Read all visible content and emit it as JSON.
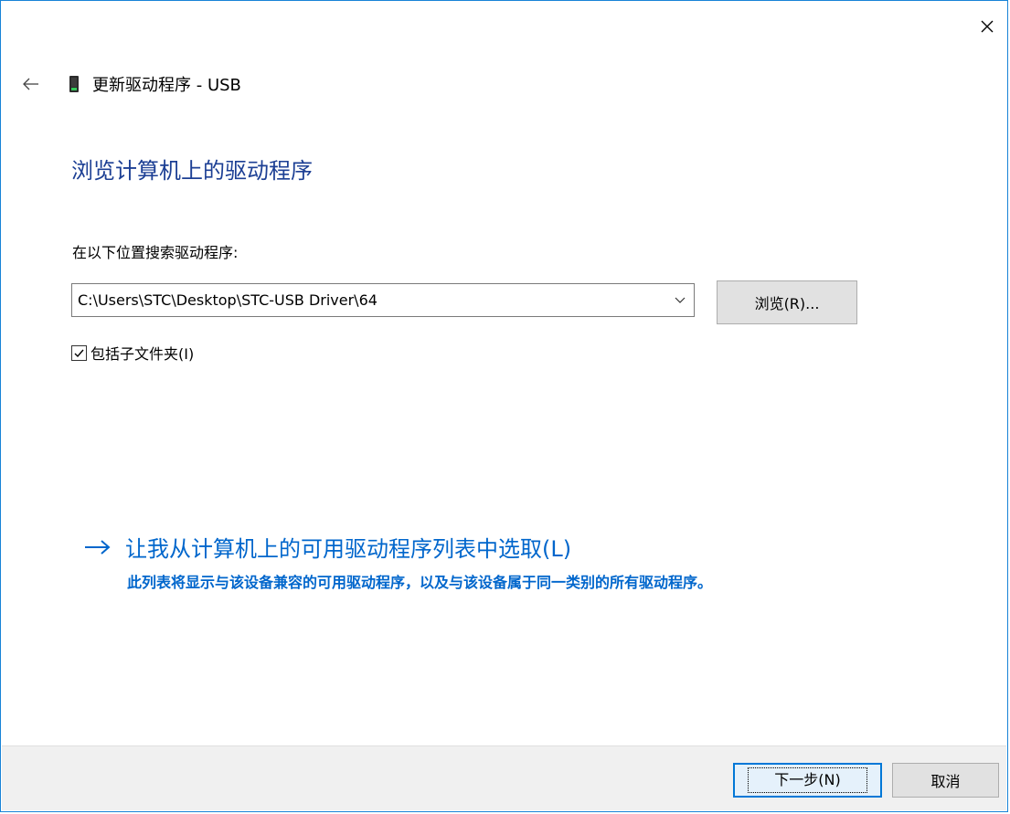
{
  "window": {
    "title": "更新驱动程序 - USB",
    "accent_color": "#1883d7"
  },
  "header": {
    "back_icon": "back-arrow-icon",
    "device_icon": "usb-device-icon",
    "close_icon": "close-icon"
  },
  "main": {
    "page_title": "浏览计算机上的驱动程序",
    "search_label": "在以下位置搜索驱动程序:",
    "path_value": "C:\\Users\\STC\\Desktop\\STC-USB Driver\\64",
    "browse_button": "浏览(R)...",
    "include_subfolders": {
      "label": "包括子文件夹(I)",
      "checked": true
    },
    "pick_from_list": {
      "label": "让我从计算机上的可用驱动程序列表中选取(L)",
      "description": "此列表将显示与该设备兼容的可用驱动程序，以及与该设备属于同一类别的所有驱动程序。"
    }
  },
  "footer": {
    "next_button": "下一步(N)",
    "cancel_button": "取消"
  },
  "colors": {
    "title_blue": "#1c3f94",
    "link_blue": "#0066cc",
    "footer_bg": "#f0f0f0"
  }
}
